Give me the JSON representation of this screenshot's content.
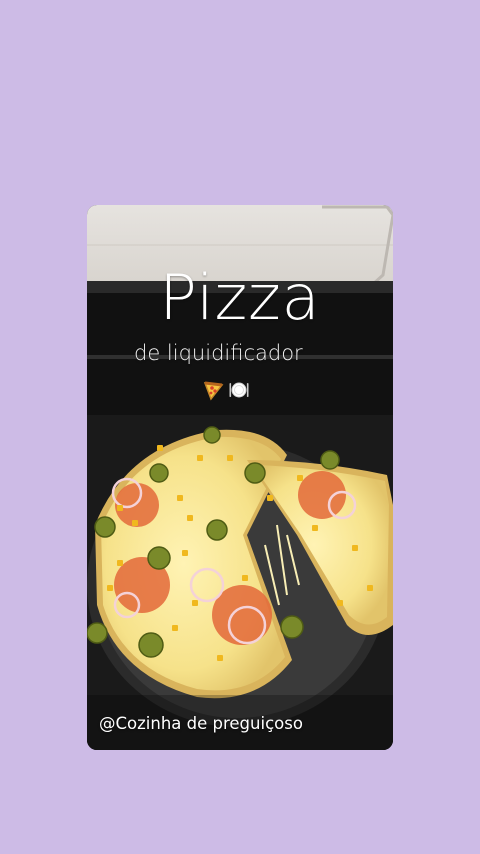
{
  "story": {
    "title": "Pizza",
    "subtitle": "de liquidificador",
    "emojis": [
      "pizza-emoji",
      "plate-cutlery-emoji"
    ],
    "handle": "@Cozinha de preguiçoso"
  },
  "colors": {
    "background": "#cdbbe6",
    "text": "#ffffff"
  }
}
